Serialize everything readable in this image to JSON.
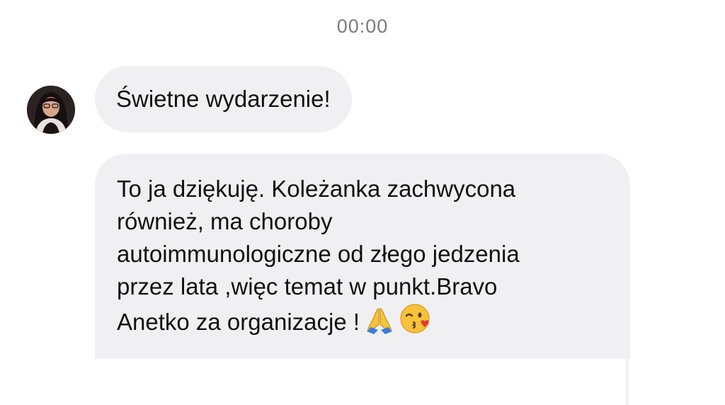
{
  "timestamp": "00:00",
  "messages": [
    {
      "sender": "incoming",
      "avatar_icon": "user-avatar-icon",
      "text": "Świetne wydarzenie!"
    },
    {
      "sender": "incoming",
      "text": "To ja dziękuję. Koleżanka zachwycona\nrównież, ma choroby\nautoimmunologiczne  od złego jedzenia\nprzez lata ,więc temat w punkt.Bravo\nAnetko za organizacje !",
      "emojis": [
        "folded-hands-icon",
        "kissing-face-icon"
      ]
    }
  ],
  "colors": {
    "bubble_bg": "#f0f0f2",
    "timestamp": "#7a7a80",
    "text": "#111111"
  }
}
